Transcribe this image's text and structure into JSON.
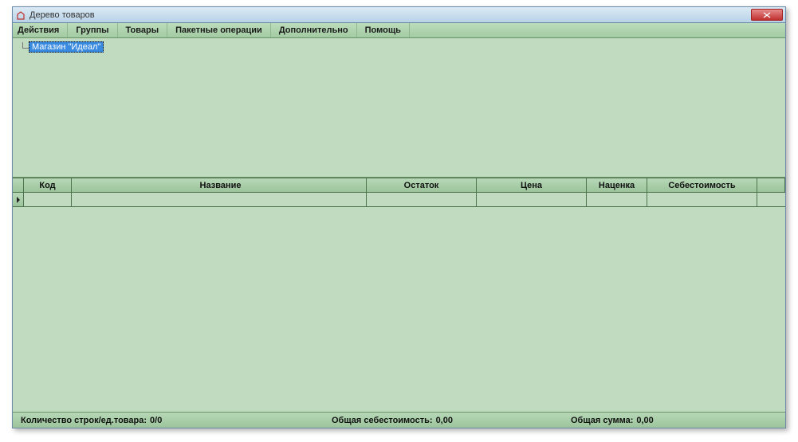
{
  "window": {
    "title": "Дерево товаров"
  },
  "menu": {
    "items": [
      "Действия",
      "Группы",
      "Товары",
      "Пакетные операции",
      "Дополнительно",
      "Помощь"
    ]
  },
  "tree": {
    "root_label": "Магазин \"Идеал\""
  },
  "grid": {
    "columns": {
      "code": "Код",
      "name": "Название",
      "rest": "Остаток",
      "price": "Цена",
      "markup": "Наценка",
      "cost": "Себестоимость"
    }
  },
  "status": {
    "rows_label": "Количество строк/ед.товара:",
    "rows_value": "0/0",
    "cost_label": "Общая себестоимость:",
    "cost_value": "0,00",
    "sum_label": "Общая сумма:",
    "sum_value": "0,00"
  }
}
